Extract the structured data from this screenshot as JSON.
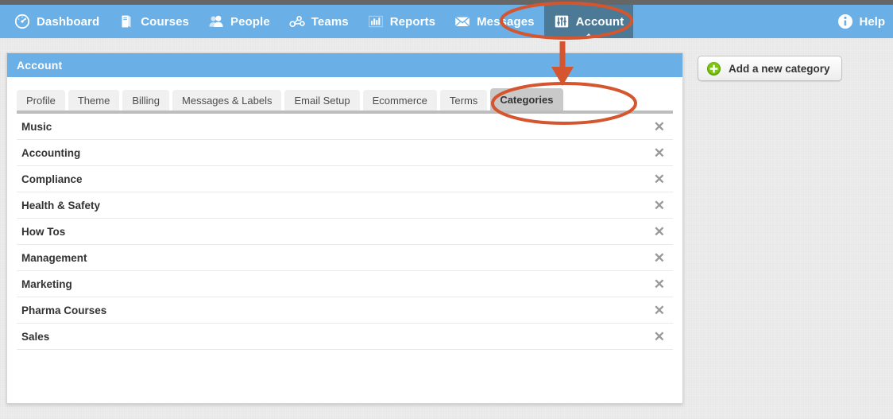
{
  "app": {
    "theme_blue": "#6aafe6",
    "active_nav_bg": "#4c7a96",
    "annotation_color": "#d4552e"
  },
  "navbar": {
    "items": [
      {
        "label": "Dashboard",
        "icon": "gauge-icon",
        "active": false
      },
      {
        "label": "Courses",
        "icon": "book-icon",
        "active": false
      },
      {
        "label": "People",
        "icon": "people-icon",
        "active": false
      },
      {
        "label": "Teams",
        "icon": "teams-icon",
        "active": false
      },
      {
        "label": "Reports",
        "icon": "barchart-icon",
        "active": false
      },
      {
        "label": "Messages",
        "icon": "envelope-icon",
        "active": false
      },
      {
        "label": "Account",
        "icon": "sliders-icon",
        "active": true
      }
    ],
    "help": {
      "label": "Help",
      "icon": "info-icon"
    }
  },
  "panel": {
    "title": "Account",
    "tabs": [
      {
        "label": "Profile",
        "active": false
      },
      {
        "label": "Theme",
        "active": false
      },
      {
        "label": "Billing",
        "active": false
      },
      {
        "label": "Messages & Labels",
        "active": false
      },
      {
        "label": "Email Setup",
        "active": false
      },
      {
        "label": "Ecommerce",
        "active": false
      },
      {
        "label": "Terms",
        "active": false
      },
      {
        "label": "Categories",
        "active": true
      }
    ],
    "categories": [
      {
        "name": "Music",
        "delete_icon": "close-icon"
      },
      {
        "name": "Accounting",
        "delete_icon": "close-icon"
      },
      {
        "name": "Compliance",
        "delete_icon": "close-icon"
      },
      {
        "name": "Health & Safety",
        "delete_icon": "close-icon"
      },
      {
        "name": "How Tos",
        "delete_icon": "close-icon"
      },
      {
        "name": "Management",
        "delete_icon": "close-icon"
      },
      {
        "name": "Marketing",
        "delete_icon": "close-icon"
      },
      {
        "name": "Pharma Courses",
        "delete_icon": "close-icon"
      },
      {
        "name": "Sales",
        "delete_icon": "close-icon"
      }
    ]
  },
  "sidebar": {
    "add_category_label": "Add a new category",
    "add_category_icon": "plus-circle-icon"
  },
  "annotations": {
    "account_ellipse": "highlight-ellipse-account",
    "categories_ellipse": "highlight-ellipse-categories",
    "arrow": "annotation-arrow-down"
  },
  "icon_glyphs": {
    "close": "✕"
  }
}
